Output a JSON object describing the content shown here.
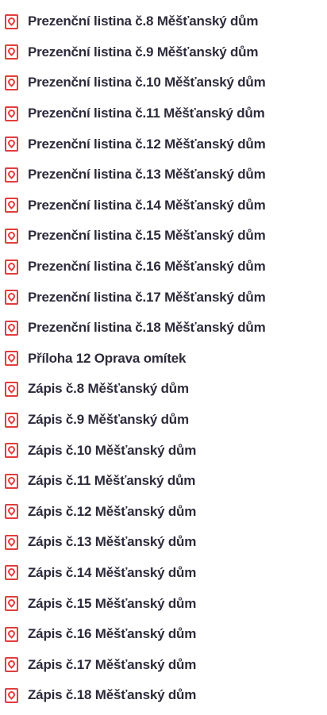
{
  "files": [
    {
      "name": "Prezenční listina č.8 Měšťanský dům"
    },
    {
      "name": "Prezenční listina č.9 Měšťanský dům"
    },
    {
      "name": "Prezenční listina č.10 Měšťanský dům"
    },
    {
      "name": "Prezenční listina č.11 Měšťanský dům"
    },
    {
      "name": "Prezenční listina č.12 Měšťanský dům"
    },
    {
      "name": "Prezenční listina č.13 Měšťanský dům"
    },
    {
      "name": "Prezenční listina č.14 Měšťanský dům"
    },
    {
      "name": "Prezenční listina č.15 Měšťanský dům"
    },
    {
      "name": "Prezenční listina č.16 Měšťanský dům"
    },
    {
      "name": "Prezenční listina č.17 Měšťanský dům"
    },
    {
      "name": "Prezenční listina č.18 Měšťanský dům"
    },
    {
      "name": "Příloha 12 Oprava omítek"
    },
    {
      "name": "Zápis č.8 Měšťanský dům"
    },
    {
      "name": "Zápis č.9 Měšťanský dům"
    },
    {
      "name": "Zápis č.10 Měšťanský dům"
    },
    {
      "name": "Zápis č.11 Měšťanský dům"
    },
    {
      "name": "Zápis č.12 Měšťanský dům"
    },
    {
      "name": "Zápis č.13 Měšťanský dům"
    },
    {
      "name": "Zápis č.14 Měšťanský dům"
    },
    {
      "name": "Zápis č.15 Měšťanský dům"
    },
    {
      "name": "Zápis č.16 Měšťanský dům"
    },
    {
      "name": "Zápis č.17 Měšťanský dům"
    },
    {
      "name": "Zápis č.18 Měšťanský dům"
    }
  ],
  "icon": "pdf-file-icon",
  "colors": {
    "icon": "#e23d3d",
    "text": "#2d2a3a",
    "background": "#ffffff"
  }
}
